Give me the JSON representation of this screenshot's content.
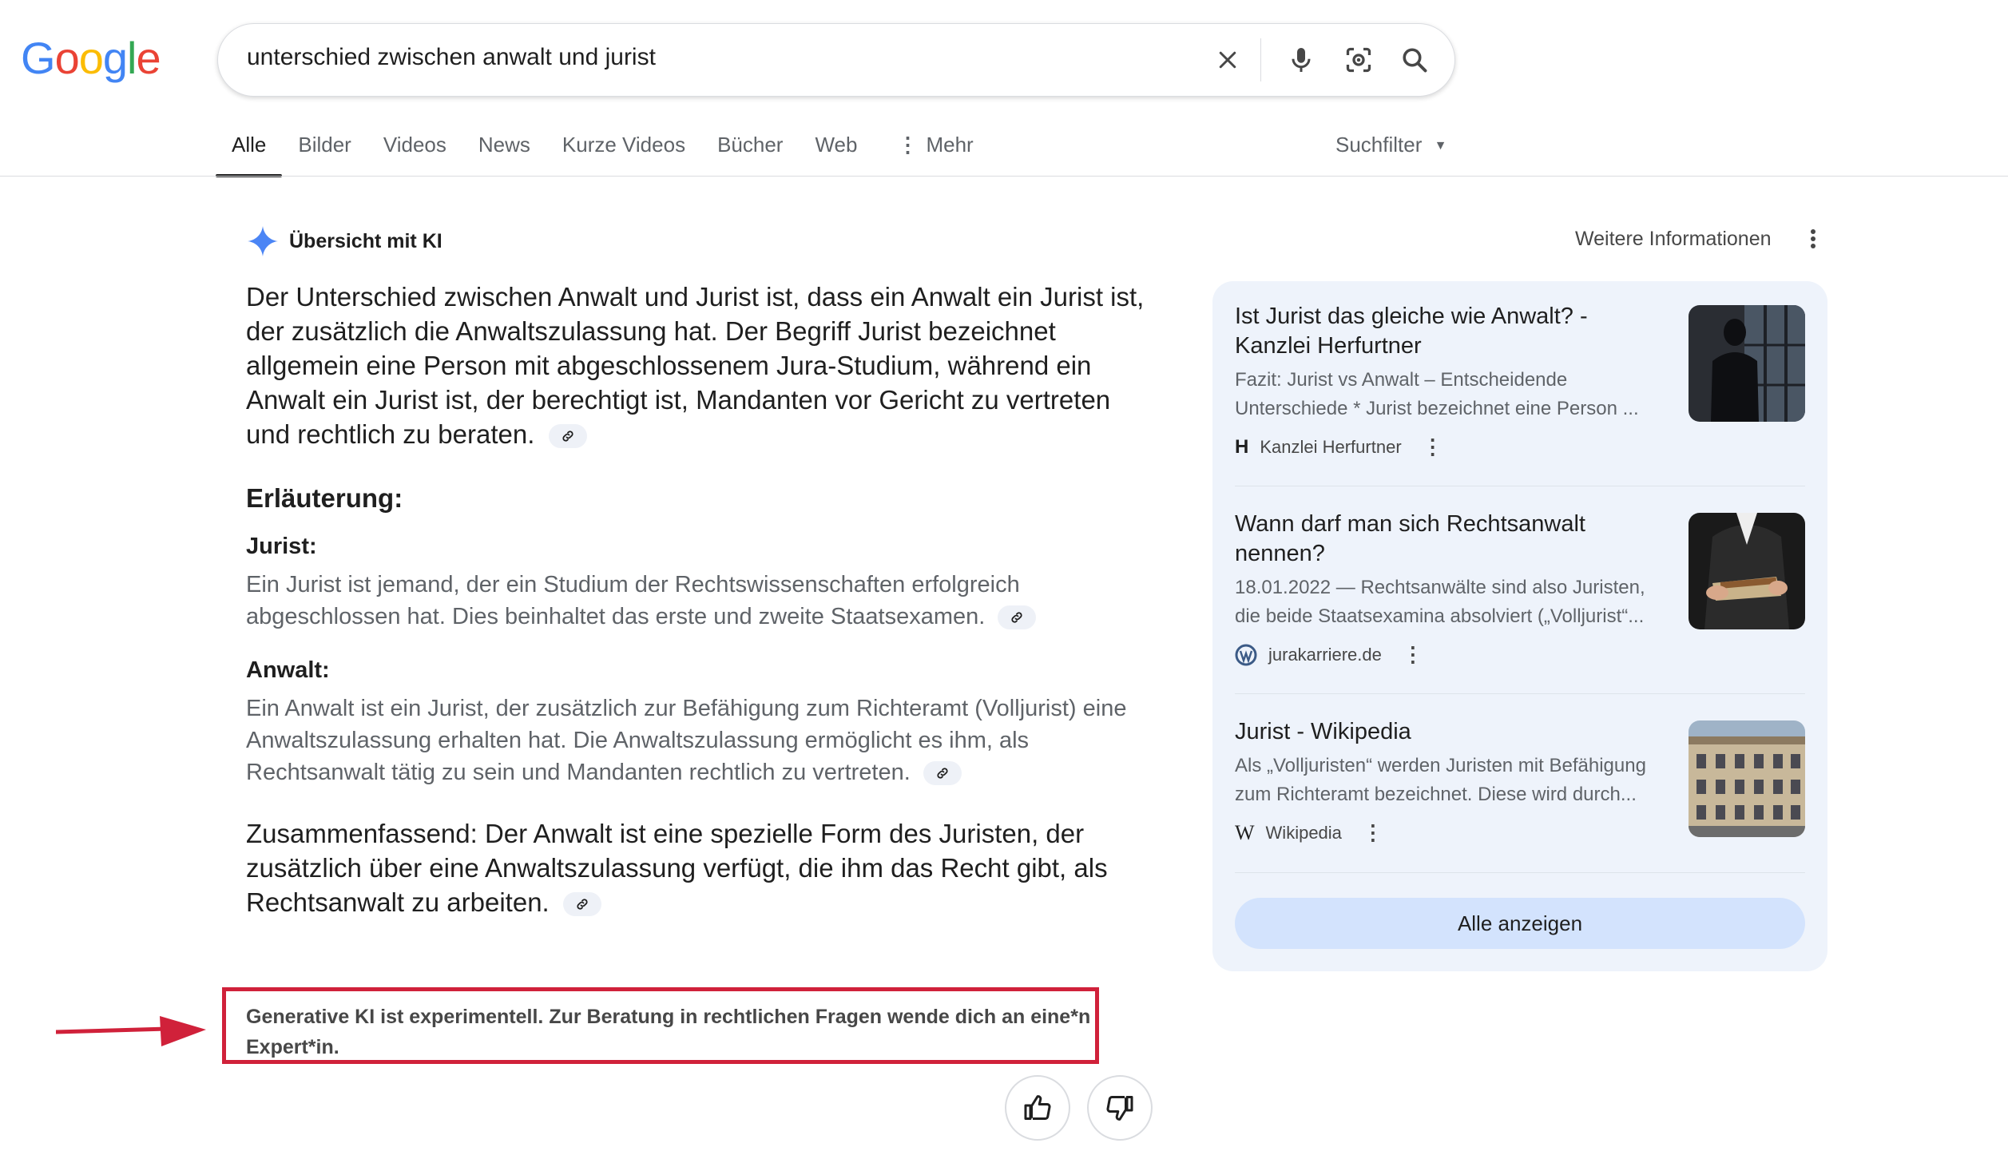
{
  "logo": {
    "text": "Google"
  },
  "search": {
    "query": "unterschied zwischen anwalt und jurist"
  },
  "tabs": [
    {
      "label": "Alle"
    },
    {
      "label": "Bilder"
    },
    {
      "label": "Videos"
    },
    {
      "label": "News"
    },
    {
      "label": "Kurze Videos"
    },
    {
      "label": "Bücher"
    },
    {
      "label": "Web"
    },
    {
      "label": "Mehr"
    }
  ],
  "filter": {
    "label": "Suchfilter"
  },
  "ai": {
    "title": "Übersicht mit KI",
    "more_info": "Weitere Informationen",
    "main": "Der Unterschied zwischen Anwalt und Jurist ist, dass ein Anwalt ein Jurist ist, der zusätzlich die Anwaltszulassung hat. Der Begriff Jurist bezeichnet allgemein eine Person mit abgeschlossenem Jura-Studium, während ein Anwalt ein Jurist ist, der berechtigt ist, Mandanten vor Gericht zu vertreten und rechtlich zu beraten.",
    "explanation_heading": "Erläuterung:",
    "jurist_heading": "Jurist:",
    "jurist_text": "Ein Jurist ist jemand, der ein Studium der Rechtswissenschaften erfolgreich abgeschlossen hat. Dies beinhaltet das erste und zweite Staatsexamen.",
    "anwalt_heading": "Anwalt:",
    "anwalt_text": "Ein Anwalt ist ein Jurist, der zusätzlich zur Befähigung zum Richteramt (Volljurist) eine Anwaltszulassung erhalten hat. Die Anwaltszulassung ermöglicht es ihm, als Rechtsanwalt tätig zu sein und Mandanten rechtlich zu vertreten.",
    "summary": "Zusammenfassend: Der Anwalt ist eine spezielle Form des Juristen, der zusätzlich über eine Anwaltszulassung verfügt, die ihm das Recht gibt, als Rechtsanwalt zu arbeiten.",
    "disclaimer": "Generative KI ist experimentell. Zur Beratung in rechtlichen Fragen wende dich an eine*n Expert*in."
  },
  "sources": [
    {
      "title": "Ist Jurist das gleiche wie Anwalt? - Kanzlei Herfurtner",
      "snippet1": "Fazit: Jurist vs Anwalt – Entscheidende",
      "snippet2": "Unterschiede * Jurist bezeichnet eine Person ...",
      "source": "Kanzlei Herfurtner"
    },
    {
      "title": "Wann darf man sich Rechtsanwalt nennen?",
      "snippet1": "18.01.2022 — Rechtsanwälte sind also Juristen,",
      "snippet2": "die beide Staatsexamina absolviert („Volljurist“...",
      "source": "jurakarriere.de"
    },
    {
      "title": "Jurist - Wikipedia",
      "snippet1": "Als „Volljuristen“ werden Juristen mit Befähigung",
      "snippet2": "zum Richteramt bezeichnet. Diese wird durch...",
      "source": "Wikipedia"
    }
  ],
  "show_all": "Alle anzeigen"
}
